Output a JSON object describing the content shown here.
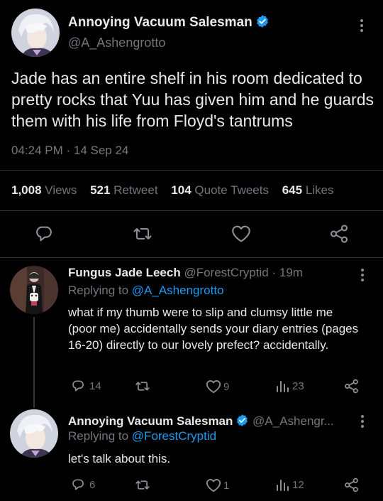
{
  "main": {
    "name": "Annoying Vacuum Salesman",
    "handle": "@A_Ashengrotto",
    "text": "Jade has an entire shelf in his room dedicated to pretty rocks that Yuu has given him and he guards them with his life from Floyd's tantrums",
    "time": "04:24 PM",
    "date": "14 Sep 24",
    "stats": {
      "views_count": "1,008",
      "views_label": "Views",
      "retweets_count": "521",
      "retweets_label": "Retweet",
      "quotes_count": "104",
      "quotes_label": "Quote Tweets",
      "likes_count": "645",
      "likes_label": "Likes"
    },
    "actions": [
      "reply-icon",
      "retweet-icon",
      "like-icon",
      "share-icon"
    ]
  },
  "replies": [
    {
      "name": "Fungus Jade Leech",
      "handle": "@ForestCryptid",
      "sep": "·",
      "time": "19m",
      "replying_label": "Replying to",
      "replying_to": "@A_Ashengrotto",
      "text": "what if my thumb were to slip and clumsy little me (poor me) accidentally sends your diary entries (pages 16-20) directly to our lovely prefect? accidentally.",
      "replies": "14",
      "likes": "9",
      "views": "23"
    },
    {
      "name": "Annoying Vacuum Salesman",
      "handle": "@A_Ashengr...",
      "replying_label": "Replying to",
      "replying_to": "@ForestCryptid",
      "text": "let's talk about this.",
      "replies": "6",
      "likes": "1",
      "views": "12"
    }
  ],
  "colors": {
    "background": "#000000",
    "accent": "#1d9bf0",
    "muted": "#71767b",
    "text": "#e7e9ea"
  }
}
